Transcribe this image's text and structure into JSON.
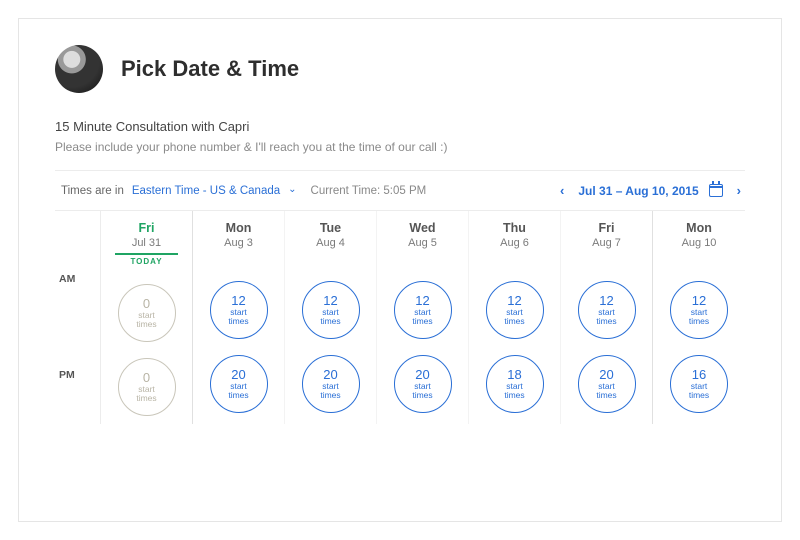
{
  "header": {
    "title": "Pick Date & Time"
  },
  "meeting": {
    "subtitle": "15 Minute Consultation with Capri",
    "description": "Please include your phone number & I'll reach you at the time of our call :)"
  },
  "toolbar": {
    "tz_prefix": "Times are in",
    "timezone": "Eastern Time - US & Canada",
    "current_time_label": "Current Time: 5:05 PM",
    "range_text": "Jul 31 – Aug 10, 2015"
  },
  "sections": {
    "am_label": "AM",
    "pm_label": "PM",
    "today_label": "TODAY",
    "slot_sub1": "start",
    "slot_sub2": "times"
  },
  "days": [
    {
      "dow": "Fri",
      "date": "Jul 31",
      "is_today": true,
      "sep_after": true,
      "am": {
        "count": "0",
        "disabled": true
      },
      "pm": {
        "count": "0",
        "disabled": true
      }
    },
    {
      "dow": "Mon",
      "date": "Aug 3",
      "is_today": false,
      "sep_after": false,
      "am": {
        "count": "12",
        "disabled": false
      },
      "pm": {
        "count": "20",
        "disabled": false
      }
    },
    {
      "dow": "Tue",
      "date": "Aug 4",
      "is_today": false,
      "sep_after": false,
      "am": {
        "count": "12",
        "disabled": false
      },
      "pm": {
        "count": "20",
        "disabled": false
      }
    },
    {
      "dow": "Wed",
      "date": "Aug 5",
      "is_today": false,
      "sep_after": false,
      "am": {
        "count": "12",
        "disabled": false
      },
      "pm": {
        "count": "20",
        "disabled": false
      }
    },
    {
      "dow": "Thu",
      "date": "Aug 6",
      "is_today": false,
      "sep_after": false,
      "am": {
        "count": "12",
        "disabled": false
      },
      "pm": {
        "count": "18",
        "disabled": false
      }
    },
    {
      "dow": "Fri",
      "date": "Aug 7",
      "is_today": false,
      "sep_after": true,
      "am": {
        "count": "12",
        "disabled": false
      },
      "pm": {
        "count": "20",
        "disabled": false
      }
    },
    {
      "dow": "Mon",
      "date": "Aug 10",
      "is_today": false,
      "sep_after": false,
      "am": {
        "count": "12",
        "disabled": false
      },
      "pm": {
        "count": "16",
        "disabled": false
      }
    }
  ]
}
